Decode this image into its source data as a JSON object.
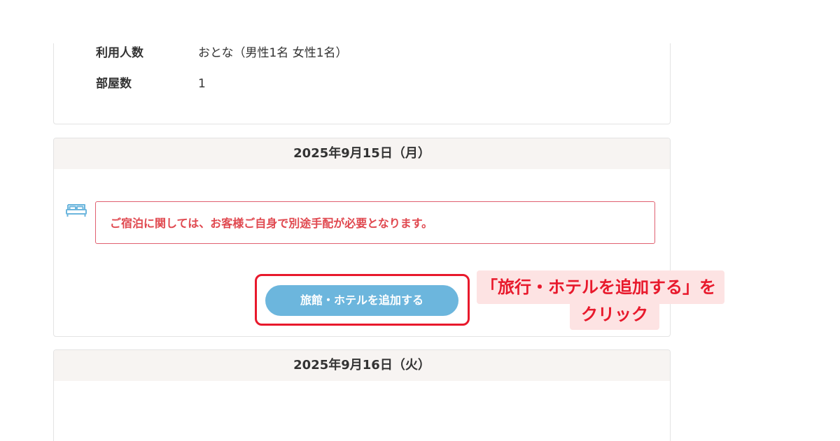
{
  "booking_info": {
    "guests_label": "利用人数",
    "guests_value": "おとな（男性1名 女性1名）",
    "rooms_label": "部屋数",
    "rooms_value": "1"
  },
  "days": [
    {
      "date": "2025年9月15日（月）",
      "notice": "ご宿泊に関しては、お客様ご自身で別途手配が必要となります。",
      "icon": "bed-icon",
      "add_hotel_label": "旅館・ホテルを追加する"
    },
    {
      "date": "2025年9月16日（火）"
    }
  ],
  "annotation": {
    "line1": "「旅行・ホテルを追加する」を",
    "line2": "クリック",
    "color": "#e8192c",
    "background": "#fde3e3"
  },
  "colors": {
    "notice_text": "#e0484f",
    "notice_border": "#e06070",
    "button": "#6cb6dd",
    "day_header_bg": "#f7f4f2",
    "icon": "#6cb6dd"
  }
}
